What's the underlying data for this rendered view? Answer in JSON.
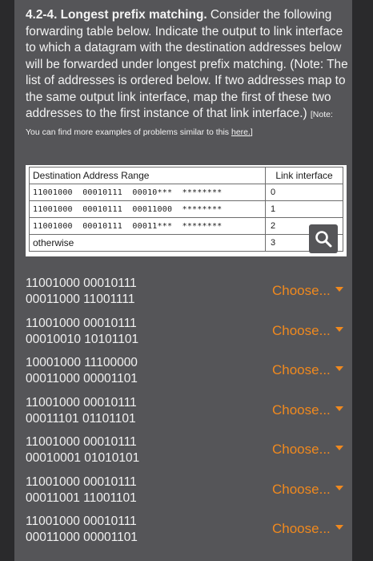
{
  "question": {
    "title": "4.2-4. Longest prefix matching.",
    "body": "Consider the following forwarding table below. Indicate the output to link interface to which a datagram with the destination addresses below will be forwarded under longest prefix matching. (Note: The list of addresses is ordered below. If two addresses map to the same output link interface, map the first of these two addresses to the first  instance of that link interface.)",
    "note_prefix": "[Note: You can find more examples of problems similar to this ",
    "note_link": "here.",
    "note_suffix": "]"
  },
  "table": {
    "header_range": "Destination Address Range",
    "header_iface": "Link interface",
    "rows": [
      {
        "bits": "11001000  00010111  00010***  ********",
        "iface": "0"
      },
      {
        "bits": "11001000  00010111  00011000  ********",
        "iface": "1"
      },
      {
        "bits": "11001000  00010111  00011***  ********",
        "iface": "2"
      },
      {
        "bits": "otherwise",
        "iface": "3"
      }
    ]
  },
  "search_icon": "search-icon",
  "addresses": [
    {
      "line1": "11001000 00010111",
      "line2": "00011000 11001111",
      "select": "Choose..."
    },
    {
      "line1": "11001000 00010111",
      "line2": "00010010 10101101",
      "select": "Choose..."
    },
    {
      "line1": "10001000 11100000",
      "line2": "00011000 00001101",
      "select": "Choose..."
    },
    {
      "line1": "11001000 00010111",
      "line2": "00011101 01101101",
      "select": "Choose..."
    },
    {
      "line1": "11001000 00010111",
      "line2": "00010001 01010101",
      "select": "Choose..."
    },
    {
      "line1": "11001000 00010111",
      "line2": "00011001 11001101",
      "select": "Choose..."
    },
    {
      "line1": "11001000 00010111",
      "line2": "00011000 00001101",
      "select": "Choose..."
    }
  ],
  "colors": {
    "accent": "#f0891e",
    "panel": "#555558"
  }
}
